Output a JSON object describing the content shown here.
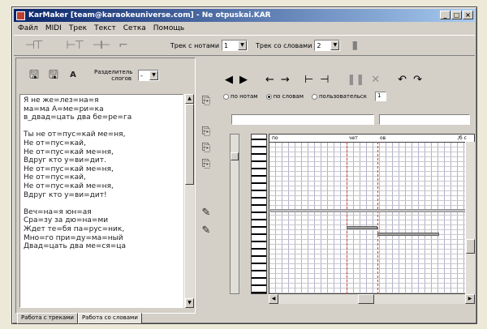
{
  "window": {
    "title": "KarMaker [team@karaokeuniverse.com] - Ne otpuskai.KAR"
  },
  "menu": [
    "Файл",
    "MIDI",
    "Трек",
    "Текст",
    "Сетка",
    "Помощь"
  ],
  "toolbar": {
    "track_notes_label": "Трек с нотами",
    "track_notes_value": "1",
    "track_words_label": "Трек со словами",
    "track_words_value": "2"
  },
  "left_toolbar": {
    "separator_label": "Разделитель слогов",
    "separator_value": "-"
  },
  "lyrics": [
    "Я не же=лез=на=я",
    "ма=ма А=ме=ри=ка",
    "в_двад=цать два бе=ре=га",
    "",
    "Ты не от=пус=кай ме=ня,",
    "Не от=пус=кай,",
    "Не от=пус=кай ме=ня,",
    "Вдруг кто у=ви=дит.",
    "Не от=пус=кай ме=ня,",
    "Не от=пус=кай,",
    "Не от=пус=кай ме=ня,",
    "Вдруг кто у=ви=дит!",
    "",
    "Веч=на=я юн=ая",
    "Сра=зу за дю=на=ми",
    "Ждет те=бя па=рус=ник,",
    "Мно=го при=ду=ма=ный",
    "Двад=цать два ме=ся=ца"
  ],
  "tabs": [
    "Работа с треками",
    "Работа со словами"
  ],
  "mode": {
    "options": [
      "по нотам",
      "по словам",
      "пользовательск"
    ],
    "selected": 1,
    "custom_value": "1"
  },
  "ruler": {
    "labels": [
      "по",
      "чет",
      "ов",
      "/б с"
    ]
  }
}
